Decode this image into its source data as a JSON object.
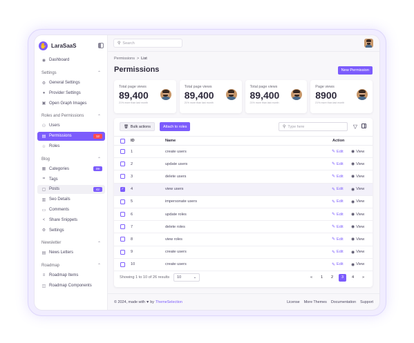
{
  "brand": {
    "name": "LaraSaaS"
  },
  "sidebar": {
    "dashboard": "Dashboard",
    "sections": [
      {
        "title": "Settings",
        "items": [
          {
            "label": "General Settings",
            "icon": "gear-icon"
          },
          {
            "label": "Provider Settings",
            "icon": "user-icon"
          },
          {
            "label": "Open Graph Images",
            "icon": "image-icon"
          }
        ]
      },
      {
        "title": "Roles and Permissions",
        "items": [
          {
            "label": "Users",
            "icon": "users-icon"
          },
          {
            "label": "Permissions",
            "icon": "lock-icon",
            "badge": "12"
          },
          {
            "label": "Roles",
            "icon": "star-icon"
          }
        ]
      },
      {
        "title": "Blog",
        "items": [
          {
            "label": "Categories",
            "icon": "grid-icon",
            "badge": "09"
          },
          {
            "label": "Tags",
            "icon": "tag-icon"
          },
          {
            "label": "Posts",
            "icon": "document-icon",
            "badge": "42"
          },
          {
            "label": "Seo Details",
            "icon": "chart-icon"
          },
          {
            "label": "Comments",
            "icon": "comment-icon"
          },
          {
            "label": "Share Snippets",
            "icon": "share-icon"
          },
          {
            "label": "Settings",
            "icon": "gear-icon"
          }
        ]
      },
      {
        "title": "Newsletter",
        "items": [
          {
            "label": "News Letters",
            "icon": "newspaper-icon"
          }
        ]
      },
      {
        "title": "Roadmap",
        "items": [
          {
            "label": "Roadmap Items",
            "icon": "list-icon"
          },
          {
            "label": "Roadmap Components",
            "icon": "components-icon"
          }
        ]
      }
    ]
  },
  "header": {
    "search_placeholder": "Search"
  },
  "breadcrumb": {
    "parent": "Permissions",
    "separator": ">",
    "current": "List"
  },
  "page": {
    "title": "Permissions",
    "new_button": "New Permission"
  },
  "stats": [
    {
      "label": "Total page views",
      "value": "89,400",
      "sub": "21% more than last month"
    },
    {
      "label": "Total page views",
      "value": "89,400",
      "sub": "21% more than last month"
    },
    {
      "label": "Total page views",
      "value": "89,400",
      "sub": "21% more than last month"
    },
    {
      "label": "Page views",
      "value": "8900",
      "sub": "21% more than last month"
    }
  ],
  "table": {
    "bulk_actions": "Bulk actions",
    "attach_button": "Attach to roles",
    "search_placeholder": "Type here",
    "columns": {
      "id": "ID",
      "name": "Name",
      "action": "Action"
    },
    "edit_label": "Edit",
    "view_label": "View",
    "rows": [
      {
        "id": "1",
        "name": "create users",
        "checked": false
      },
      {
        "id": "2",
        "name": "update users",
        "checked": false
      },
      {
        "id": "3",
        "name": "delete users",
        "checked": false
      },
      {
        "id": "4",
        "name": "view users",
        "checked": true
      },
      {
        "id": "5",
        "name": "impersonate users",
        "checked": false
      },
      {
        "id": "6",
        "name": "update roles",
        "checked": false
      },
      {
        "id": "7",
        "name": "delete roles",
        "checked": false
      },
      {
        "id": "8",
        "name": "view roles",
        "checked": false
      },
      {
        "id": "9",
        "name": "create users",
        "checked": false
      },
      {
        "id": "10",
        "name": "create users",
        "checked": false
      }
    ],
    "showing": "Showing 1 to 10 of 26 results",
    "per_page": "10",
    "pages": [
      "1",
      "2",
      "3",
      "4"
    ],
    "active_page": "3",
    "first_label": "«",
    "last_label": "»"
  },
  "footer": {
    "copyright": "© 2024, made with",
    "by": "by",
    "company": "ThemeSelection",
    "links": [
      "License",
      "More Themes",
      "Documentation",
      "Support"
    ]
  },
  "colors": {
    "accent": "#7c5cfc",
    "danger": "#ff4c51"
  }
}
